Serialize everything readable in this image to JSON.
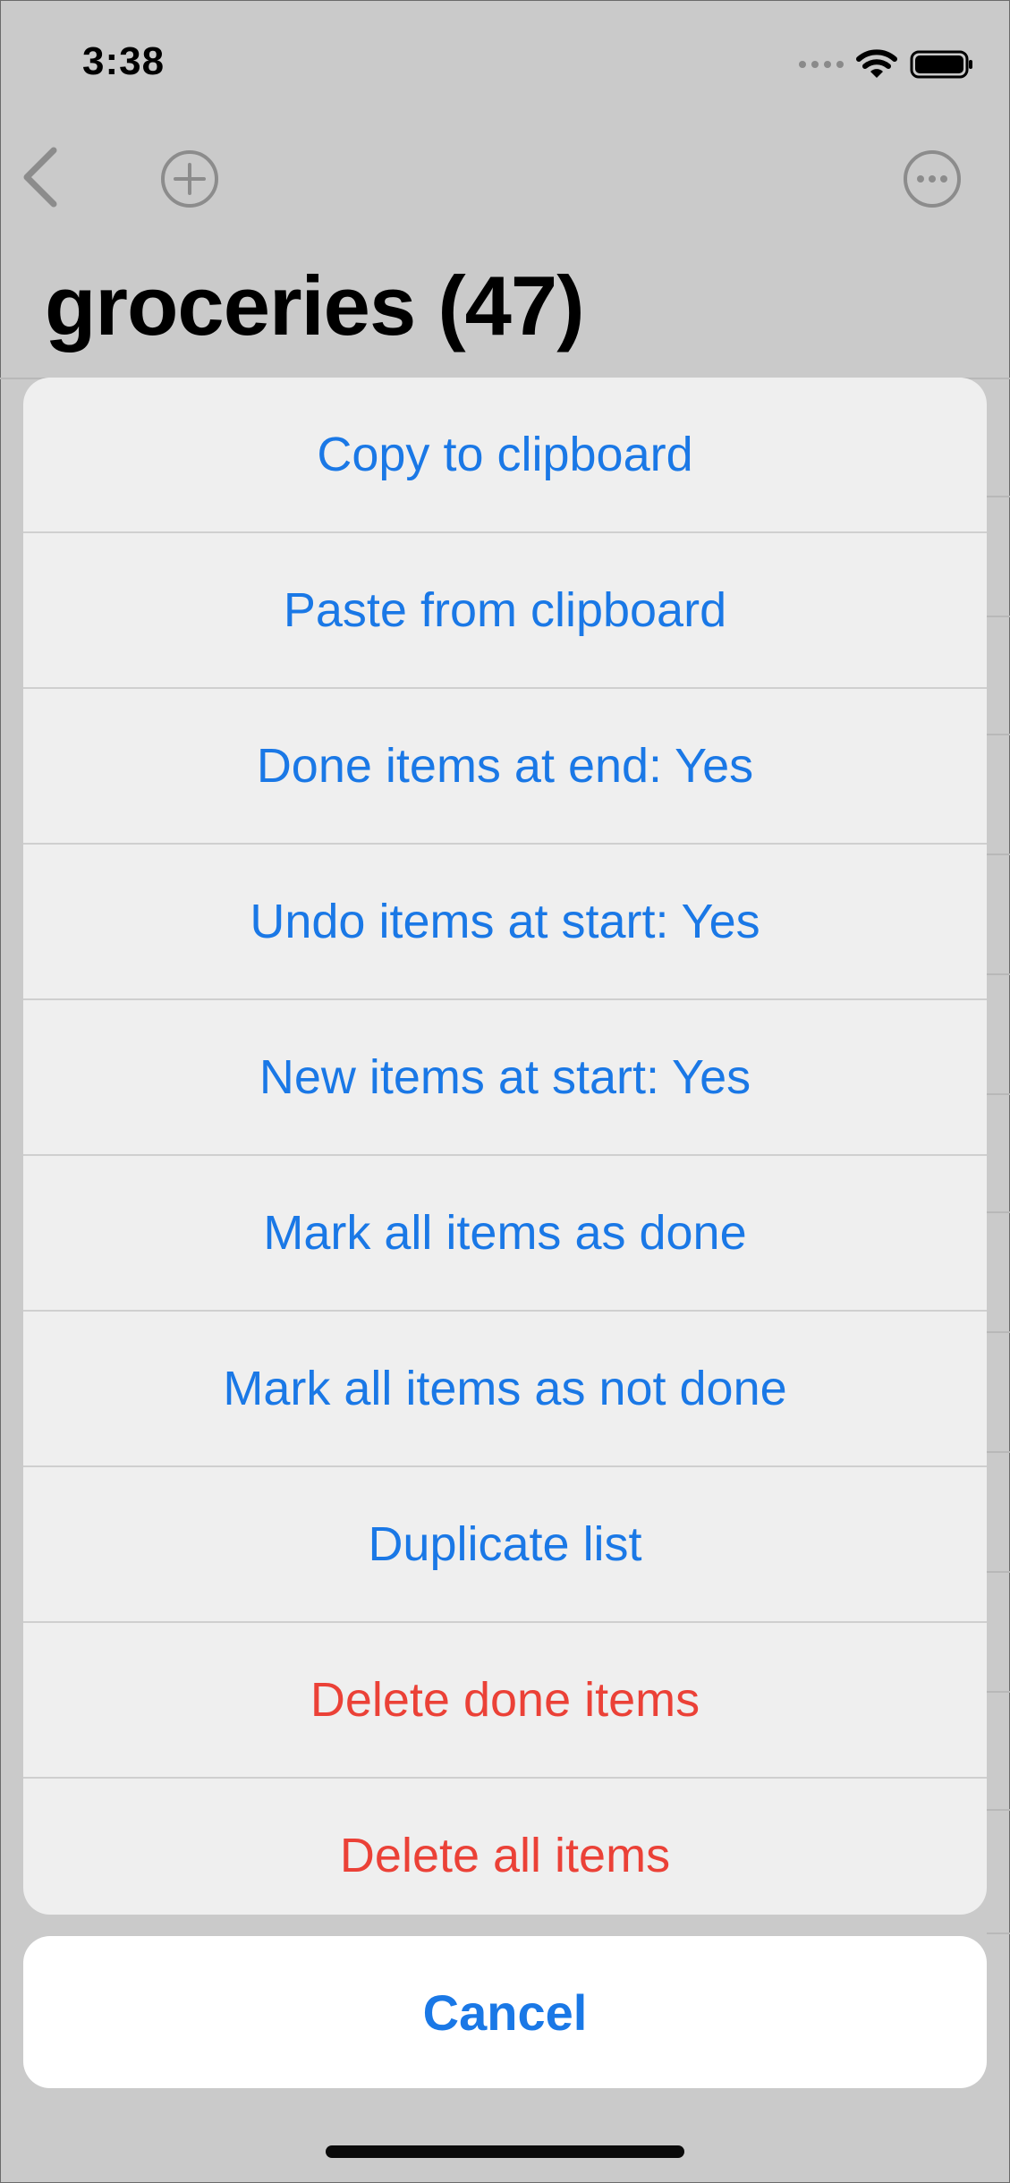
{
  "status_bar": {
    "time": "3:38",
    "icons": [
      "signal-dots-icon",
      "wifi-icon",
      "battery-icon"
    ]
  },
  "nav": {
    "back_icon": "chevron-left-icon",
    "add_icon": "plus-circle-icon",
    "more_icon": "ellipsis-circle-icon"
  },
  "page": {
    "title": "groceries (47)"
  },
  "action_sheet": {
    "items": [
      {
        "label": "Copy to clipboard",
        "style": "default"
      },
      {
        "label": "Paste from clipboard",
        "style": "default"
      },
      {
        "label": "Done items at end: Yes",
        "style": "default"
      },
      {
        "label": "Undo items at start: Yes",
        "style": "default"
      },
      {
        "label": "New items at start: Yes",
        "style": "default"
      },
      {
        "label": "Mark all items as done",
        "style": "default"
      },
      {
        "label": "Mark all items as not done",
        "style": "default"
      },
      {
        "label": "Duplicate list",
        "style": "default"
      },
      {
        "label": "Delete done items",
        "style": "destructive"
      },
      {
        "label": "Delete all items",
        "style": "destructive"
      }
    ],
    "cancel_label": "Cancel"
  },
  "colors": {
    "accent": "#1a78e6",
    "destructive": "#eb4137",
    "dimmed_background": "#cacaca",
    "sheet_background": "#efefef"
  }
}
